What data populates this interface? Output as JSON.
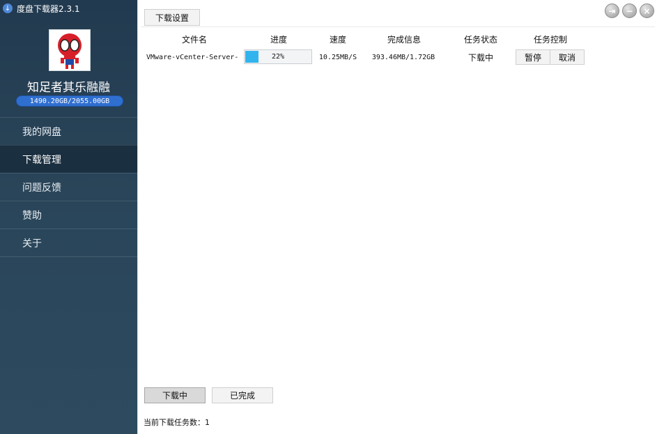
{
  "app": {
    "title": "度盘下载器2.3.1",
    "icon": "download-arrow-icon"
  },
  "user": {
    "name": "知足者其乐融融",
    "quota": "1490.20GB/2055.00GB",
    "avatar": "spiderman-avatar"
  },
  "sidebar": {
    "items": [
      {
        "label": "我的网盘",
        "active": false
      },
      {
        "label": "下载管理",
        "active": true
      },
      {
        "label": "问题反馈",
        "active": false
      },
      {
        "label": "赞助",
        "active": false
      },
      {
        "label": "关于",
        "active": false
      }
    ]
  },
  "toolbar": {
    "settings_label": "下载设置"
  },
  "window": {
    "controls": [
      "logout-icon",
      "minimize-icon",
      "close-icon"
    ]
  },
  "table": {
    "headers": [
      "文件名",
      "进度",
      "速度",
      "完成信息",
      "任务状态",
      "任务控制"
    ],
    "rows": [
      {
        "filename": "VMware-vCenter-Server-",
        "progress": 22,
        "progress_text": "22%",
        "speed": "10.25MB/S",
        "done_info": "393.46MB/1.72GB",
        "status": "下载中",
        "pause_label": "暂停",
        "cancel_label": "取消"
      }
    ]
  },
  "tabs": {
    "downloading_label": "下载中",
    "done_label": "已完成"
  },
  "status_line": "当前下载任务数：1",
  "colors": {
    "sidebar": "#2a4559",
    "progress": "#31b4ee",
    "quota": "#2f6fd0"
  }
}
